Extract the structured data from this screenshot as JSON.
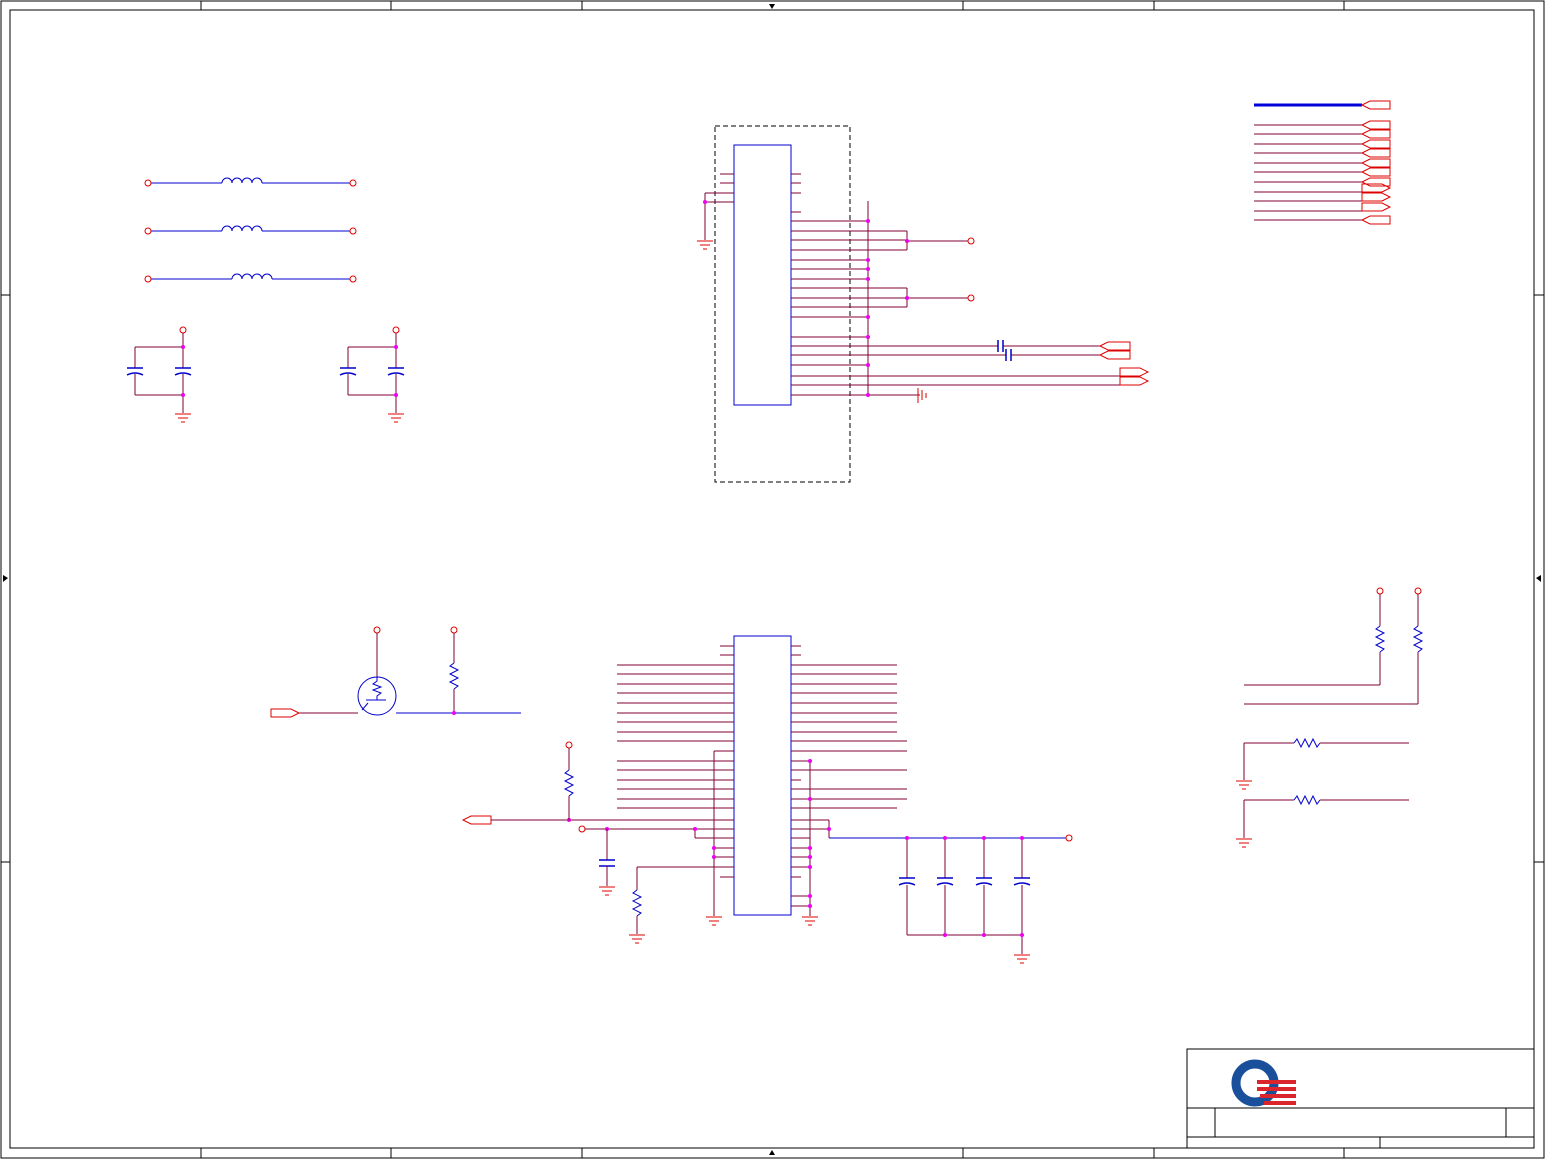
{
  "sheet": {
    "border_color": "#000000",
    "net_color": "#800033",
    "wire_color": "#0000cc",
    "port_color": "#dd0000",
    "junction_color": "#ee00ee",
    "bus_color": "#0000dd"
  },
  "logo": {
    "name": "quanta-logo",
    "ring_color": "#1a4f9c",
    "stripe_color": "#d9252b"
  },
  "title_block": {
    "title": "",
    "size": "",
    "doc_number": "",
    "rev": ""
  }
}
